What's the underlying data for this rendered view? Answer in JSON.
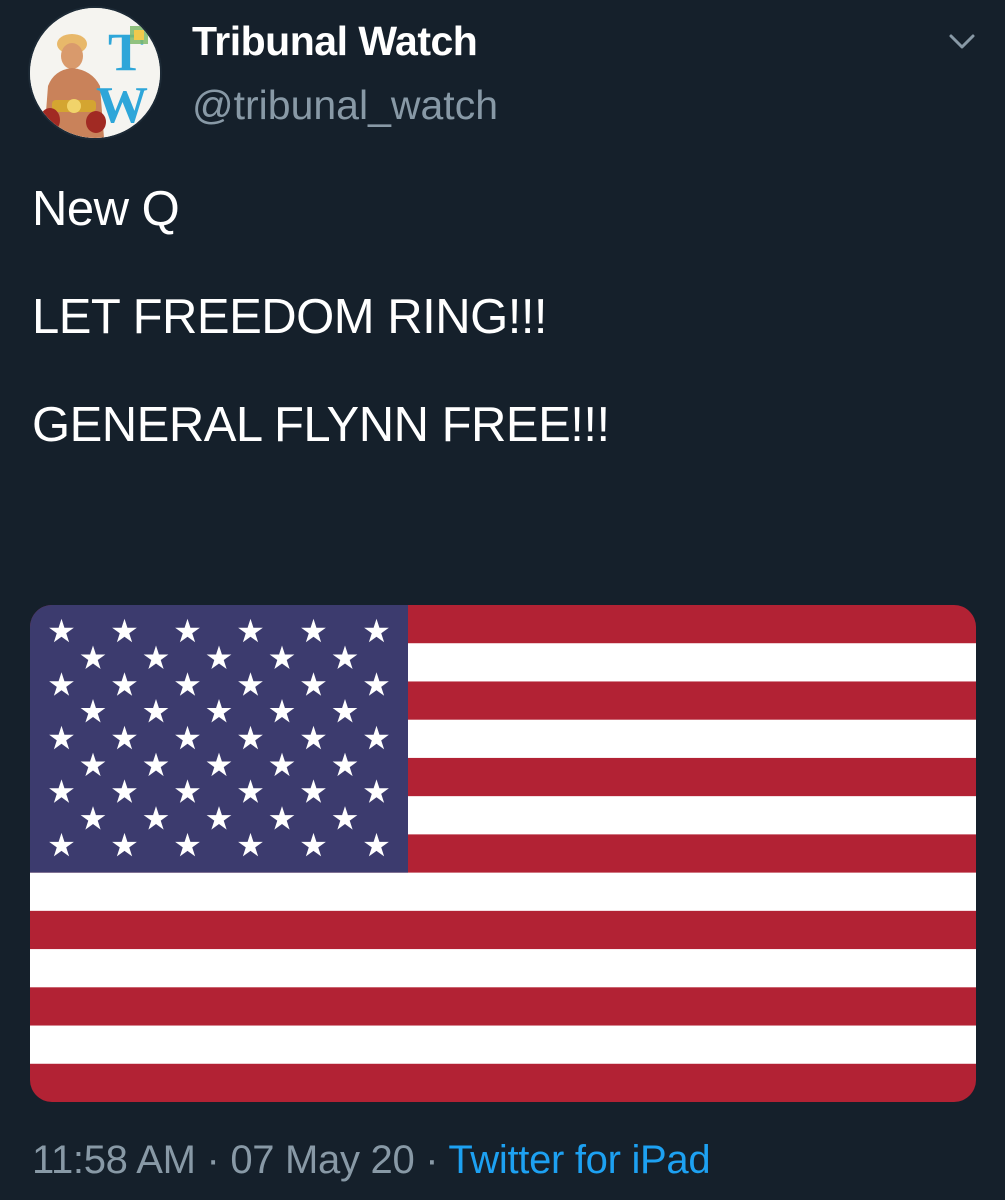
{
  "account": {
    "display_name": "Tribunal Watch",
    "handle": "@tribunal_watch",
    "avatar_monogram": "TW"
  },
  "tweet": {
    "lines": [
      "New Q",
      "LET FREEDOM RING!!!",
      "GENERAL FLYNN FREE!!!"
    ]
  },
  "media": {
    "description_icon": "us-flag-image",
    "colors": {
      "red": "#b22234",
      "white": "#ffffff",
      "blue": "#3c3b6e"
    }
  },
  "meta": {
    "time": "11:58 AM",
    "separator": "·",
    "date": "07 May 20",
    "source": "Twitter for iPad"
  },
  "colors": {
    "background": "#15202b",
    "text": "#ffffff",
    "muted": "#8899a6",
    "link": "#1da1f2"
  }
}
